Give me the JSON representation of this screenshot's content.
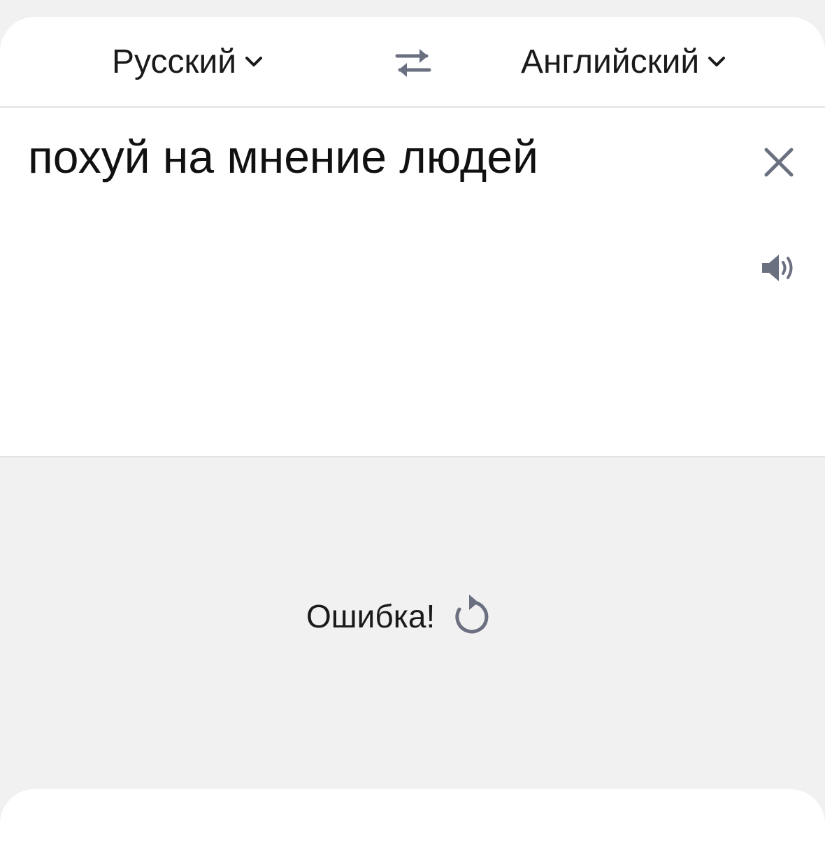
{
  "languages": {
    "source": "Русский",
    "target": "Английский"
  },
  "input": {
    "text": "похуй на мнение людей"
  },
  "result": {
    "error_text": "Ошибка!"
  },
  "icons": {
    "swap": "swap-arrows-icon",
    "chevron": "chevron-down-icon",
    "clear": "close-icon",
    "speaker": "speaker-icon",
    "retry": "refresh-icon"
  },
  "colors": {
    "icon_gray": "#6b7080",
    "background": "#f1f1f1",
    "card": "#ffffff"
  }
}
